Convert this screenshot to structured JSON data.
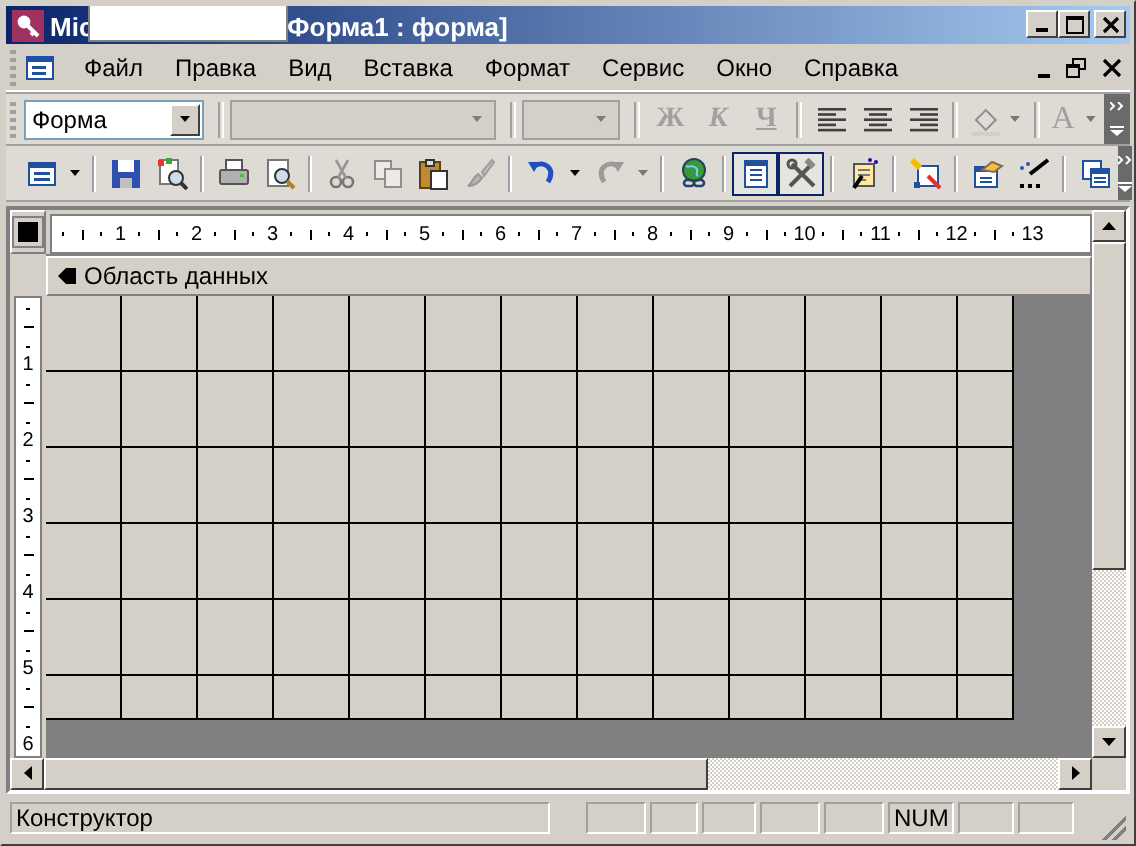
{
  "window": {
    "title_start": "Mic",
    "title_end": "Форма1 : форма]"
  },
  "menu": [
    "Файл",
    "Правка",
    "Вид",
    "Вставка",
    "Формат",
    "Сервис",
    "Окно",
    "Справка"
  ],
  "format_toolbar": {
    "object": "Форма",
    "font_disabled": true,
    "size_disabled": true,
    "styles": [
      {
        "label": "Ж",
        "disabled": true
      },
      {
        "label": "К",
        "disabled": true
      },
      {
        "label": "Ч",
        "disabled": true
      }
    ],
    "fill_disabled": true,
    "font_color": {
      "label": "A",
      "disabled": true
    }
  },
  "standard_toolbar": [
    {
      "disabled": false,
      "selected": false
    },
    {
      "disabled": false,
      "selected": false
    },
    {
      "disabled": false,
      "selected": false
    },
    {
      "disabled": false,
      "selected": false
    },
    {
      "disabled": false,
      "selected": false
    },
    {
      "disabled": true,
      "selected": false
    },
    {
      "disabled": true,
      "selected": false
    },
    {
      "disabled": false,
      "selected": false
    },
    {
      "disabled": true,
      "selected": false
    },
    {
      "disabled": false,
      "selected": false
    },
    {
      "disabled": true,
      "selected": false
    },
    {
      "disabled": false,
      "selected": false
    },
    {
      "disabled": false,
      "selected": true
    },
    {
      "disabled": false,
      "selected": true
    },
    {
      "disabled": false,
      "selected": false
    },
    {
      "disabled": false,
      "selected": false
    },
    {
      "disabled": false,
      "selected": false
    },
    {
      "disabled": false,
      "selected": false
    },
    {
      "disabled": false,
      "selected": false
    }
  ],
  "ruler": {
    "horizontal": [
      "1",
      "2",
      "3",
      "4",
      "5",
      "6",
      "7",
      "8",
      "9",
      "10",
      "11",
      "12",
      "13"
    ],
    "vertical": [
      "1",
      "2",
      "3",
      "4",
      "5",
      "6"
    ]
  },
  "section": "Область данных",
  "status_bar": {
    "mode": "Конструктор",
    "indicators": [
      "NUM"
    ]
  }
}
